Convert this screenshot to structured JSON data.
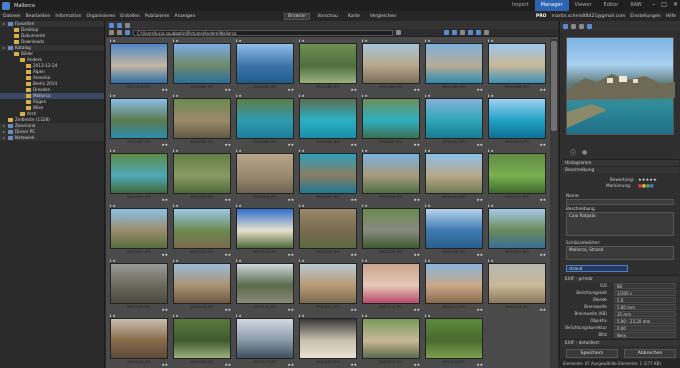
{
  "window": {
    "title": "Mallorca"
  },
  "modes": [
    {
      "label": "Import",
      "active": false
    },
    {
      "label": "Manager",
      "active": true
    },
    {
      "label": "Viewer",
      "active": false
    },
    {
      "label": "Editor",
      "active": false
    },
    {
      "label": "RAW",
      "active": false
    }
  ],
  "menu": [
    "Dateien",
    "Bearbeiten",
    "Information",
    "Organisieren",
    "Erstellen",
    "Publizieren",
    "Anzeigen"
  ],
  "view_tabs": [
    {
      "label": "Browser",
      "active": true
    },
    {
      "label": "Vorschau",
      "active": false
    },
    {
      "label": "Karte",
      "active": false
    },
    {
      "label": "Vergleichen",
      "active": false
    }
  ],
  "menubar_right": {
    "badge": "PRO",
    "email": "martin.schmidt8421@gmail.com",
    "settings": "Einstellungen",
    "help": "Hilfe"
  },
  "path": "C:\\Users\\lucia.soubbotin\\Pictures\\Andere\\Mallorca",
  "sidebar": [
    {
      "label": "Favoriten",
      "level": 0,
      "kind": "section"
    },
    {
      "label": "Desktop",
      "level": 1,
      "kind": "folder"
    },
    {
      "label": "Dokumente",
      "level": 1,
      "kind": "folder"
    },
    {
      "label": "Downloads",
      "level": 1,
      "kind": "folder"
    },
    {
      "label": "Katalog",
      "level": 0,
      "kind": "section"
    },
    {
      "label": "Bilder",
      "level": 1,
      "kind": "folder"
    },
    {
      "label": "Andere",
      "level": 2,
      "kind": "folder"
    },
    {
      "label": "2013-12-24",
      "level": 3,
      "kind": "folder"
    },
    {
      "label": "Alpen",
      "level": 3,
      "kind": "folder"
    },
    {
      "label": "Amerika",
      "level": 3,
      "kind": "folder"
    },
    {
      "label": "Berlin 2014",
      "level": 3,
      "kind": "folder"
    },
    {
      "label": "Dresden",
      "level": 3,
      "kind": "folder"
    },
    {
      "label": "Mallorca",
      "level": 3,
      "kind": "folder",
      "selected": true
    },
    {
      "label": "Rügen",
      "level": 3,
      "kind": "folder"
    },
    {
      "label": "Wien",
      "level": 3,
      "kind": "folder"
    },
    {
      "label": "Arch",
      "level": 2,
      "kind": "folder"
    },
    {
      "label": "Zeitleiste (1328)",
      "level": 0,
      "kind": "folder"
    },
    {
      "label": "Zoneraria",
      "level": 0,
      "kind": "section"
    },
    {
      "label": "Dieser PC",
      "level": 0,
      "kind": "section"
    },
    {
      "label": "Netzwerk",
      "level": 0,
      "kind": "section"
    }
  ],
  "thumbnails": [
    {
      "name": "IMG0079.JPG",
      "colors": [
        "#4f87c6",
        "#c4b7a2",
        "#2d6fa6"
      ]
    },
    {
      "name": "IMG0080.JPG",
      "colors": [
        "#7aaee2",
        "#6f8a6a",
        "#2a6f9c"
      ]
    },
    {
      "name": "IMG0082.JPG",
      "colors": [
        "#8fbfe8",
        "#3f74a8",
        "#1e5c8a"
      ]
    },
    {
      "name": "IMG0083.JPG",
      "colors": [
        "#6f8f52",
        "#4f6f3e",
        "#9ab07f"
      ]
    },
    {
      "name": "IMG0084.JPG",
      "colors": [
        "#a7c4d6",
        "#b7a88c",
        "#7a6e5c"
      ]
    },
    {
      "name": "IMG0085.JPG",
      "colors": [
        "#7eb0dd",
        "#b8ac95",
        "#2e8bb0"
      ]
    },
    {
      "name": "IMG0086.JPG",
      "colors": [
        "#9cc6ea",
        "#c9b898",
        "#3b8fb8"
      ]
    },
    {
      "name": "IMG0087.JPG",
      "colors": [
        "#89bde6",
        "#5b7a4f",
        "#2a8ca8"
      ]
    },
    {
      "name": "IMG0088.JPG",
      "colors": [
        "#6b8a4e",
        "#9a8a6a",
        "#5f5a44"
      ]
    },
    {
      "name": "IMG0089.JPG",
      "colors": [
        "#5d7c49",
        "#2f9bb2",
        "#1b7d98"
      ]
    },
    {
      "name": "IMG0090.JPG",
      "colors": [
        "#5a6f52",
        "#2bb2c6",
        "#1a8ea8"
      ]
    },
    {
      "name": "IMG0091.JPG",
      "colors": [
        "#6b8f5a",
        "#2fb0c0",
        "#3c6e52"
      ]
    },
    {
      "name": "IMG0092.JPG",
      "colors": [
        "#86b2d8",
        "#2fa6b8",
        "#187a92"
      ]
    },
    {
      "name": "IMG0093.JPG",
      "colors": [
        "#9fcff0",
        "#1fa2c4",
        "#0f7094"
      ]
    },
    {
      "name": "IMG0094.JPG",
      "colors": [
        "#5c8a44",
        "#4fa8b8",
        "#3f6a3a"
      ]
    },
    {
      "name": "IMG0095.JPG",
      "colors": [
        "#647d46",
        "#8a9a62",
        "#4e6a3a"
      ]
    },
    {
      "name": "IMG0096.JPG",
      "colors": [
        "#b7a58a",
        "#9a8a70",
        "#6e6250"
      ]
    },
    {
      "name": "IMG0097.JPG",
      "colors": [
        "#2fa0b8",
        "#8a7c62",
        "#1c7a94"
      ]
    },
    {
      "name": "IMG0098.JPG",
      "colors": [
        "#7ab2de",
        "#a89a7c",
        "#4f6f44"
      ]
    },
    {
      "name": "IMG0099.JPG",
      "colors": [
        "#8cc0e8",
        "#b8a88a",
        "#6e7a52"
      ]
    },
    {
      "name": "IMG0100.JPG",
      "colors": [
        "#5f8a46",
        "#7ab04f",
        "#3e6a2e"
      ]
    },
    {
      "name": "IMG0101.JPG",
      "colors": [
        "#8cbfe6",
        "#9a8c6c",
        "#556e3e"
      ]
    },
    {
      "name": "IMG0102.JPG",
      "colors": [
        "#9cc8ea",
        "#6a8a4e",
        "#7a6a4e"
      ]
    },
    {
      "name": "IMG0103.JPG",
      "colors": [
        "#2f6fd0",
        "#e8e0cc",
        "#4e6a3a"
      ]
    },
    {
      "name": "IMG0104.JPG",
      "colors": [
        "#9a8a6a",
        "#7a6a4e",
        "#5a6a3e"
      ]
    },
    {
      "name": "IMG0105.JPG",
      "colors": [
        "#6a8a4e",
        "#8a8a80",
        "#3e5a2e"
      ]
    },
    {
      "name": "IMG0106.JPG",
      "colors": [
        "#b8d4ee",
        "#3e7ab0",
        "#2a5e8c"
      ]
    },
    {
      "name": "IMG0107.JPG",
      "colors": [
        "#a8c8e6",
        "#6a8a5a",
        "#3a6e98"
      ]
    },
    {
      "name": "IMG0108.JPG",
      "colors": [
        "#9a9a9a",
        "#6a6a5a",
        "#4a4a40"
      ]
    },
    {
      "name": "IMG0109.JPG",
      "colors": [
        "#9cbcd8",
        "#a89272",
        "#6e5a44"
      ]
    },
    {
      "name": "IMG0110.JPG",
      "colors": [
        "#cfd6dc",
        "#5a6a4a",
        "#8a8a7a"
      ]
    },
    {
      "name": "IMG0111.JPG",
      "colors": [
        "#b8c8d4",
        "#b89a74",
        "#7a6a52"
      ]
    },
    {
      "name": "IMG0112.JPG",
      "colors": [
        "#c8a48a",
        "#e6c8b8",
        "#b84a6a"
      ]
    },
    {
      "name": "IMG0113.JPG",
      "colors": [
        "#8ab4dc",
        "#c8a888",
        "#8a6a4e"
      ]
    },
    {
      "name": "IMG0114.JPG",
      "colors": [
        "#b8b8b0",
        "#c8b898",
        "#8a7a5e"
      ]
    },
    {
      "name": "IMG0115.JPG",
      "colors": [
        "#c8c0b0",
        "#8a6a4a",
        "#5a4a3a"
      ]
    },
    {
      "name": "IMG0116.JPG",
      "colors": [
        "#5a7a3e",
        "#3e5a2e",
        "#9ab07a"
      ]
    },
    {
      "name": "IMG0117.JPG",
      "colors": [
        "#d0d8e0",
        "#8a9aa8",
        "#3e4e5e"
      ]
    },
    {
      "name": "IMG0118.JPG",
      "colors": [
        "#3a3a3a",
        "#c8c0b0",
        "#e8e0d0"
      ]
    },
    {
      "name": "IMG0119.JPG",
      "colors": [
        "#7a9a5a",
        "#c8b898",
        "#5a6a4a"
      ]
    },
    {
      "name": "IMG0120.JPG",
      "colors": [
        "#5a8a3e",
        "#4a6a2e",
        "#7aa04e"
      ]
    }
  ],
  "right_panel": {
    "tabs": [
      "info-tab",
      "tags-tab",
      "layers-tab"
    ],
    "sections": {
      "histogram": "Histogramm",
      "description": "Beschreibung",
      "exif_primary": "EXIF - primär",
      "exif_detailed": "EXIF - detailliert"
    },
    "rating_label": "Bewertung:",
    "marker_label": "Markierung:",
    "name_label": "Name:",
    "caption_label": "Beschreibung:",
    "caption_value": "Cala Ratjada",
    "keywords_label": "Schlüsselwörter:",
    "keywords_value": "Mallorca, Strand",
    "keyword_input": "strand",
    "exif": [
      {
        "key": "ISO",
        "value": "80"
      },
      {
        "key": "Belichtungszeit",
        "value": "1/300 s"
      },
      {
        "key": "Blende",
        "value": "5.6"
      },
      {
        "key": "Brennweite",
        "value": "5.80 mm"
      },
      {
        "key": "Brennweite (KB)",
        "value": "35 mm"
      },
      {
        "key": "Objektiv",
        "value": "5.80 - 23.20 mm"
      },
      {
        "key": "Belichtungskorrektur",
        "value": "0.00"
      },
      {
        "key": "Blitz",
        "value": "Nein"
      }
    ],
    "save_label": "Speichern",
    "cancel_label": "Abbrechen"
  },
  "status": {
    "text": "Elemente: 47    Ausgewählte Elemente: 1 (277 KB)"
  },
  "colors": {
    "accent": "#2d63b3",
    "folder": "#d6b04a",
    "selection": "#3a4a66"
  }
}
